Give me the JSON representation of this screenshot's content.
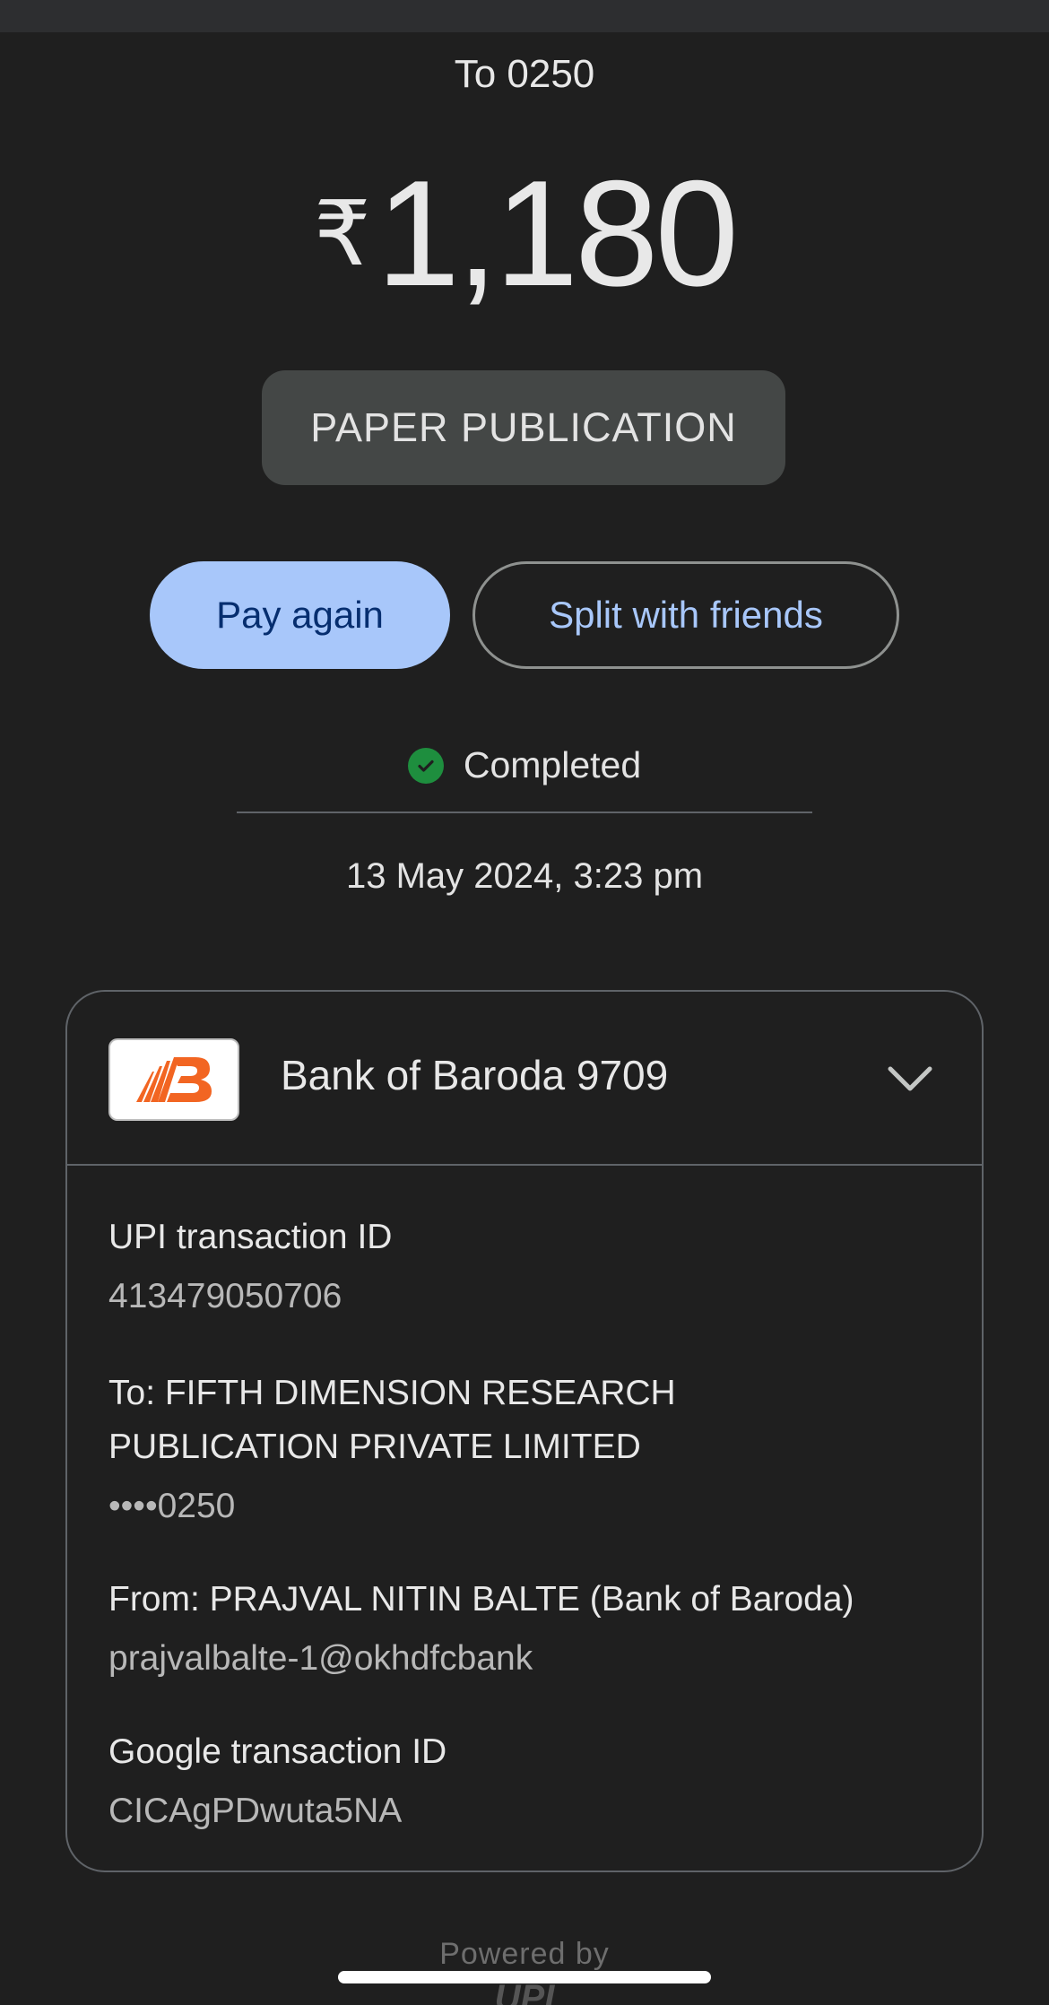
{
  "header": {
    "to_title": "To 0250"
  },
  "amount": {
    "currency": "₹",
    "value": "1,180"
  },
  "note": "PAPER PUBLICATION",
  "actions": {
    "pay_again": "Pay again",
    "split": "Split with friends"
  },
  "status": {
    "text": "Completed",
    "color": "#1e8e3e"
  },
  "datetime": "13 May 2024, 3:23 pm",
  "bank": {
    "name": "Bank of Baroda 9709",
    "logo_color": "#f26522"
  },
  "details": {
    "upi_label": "UPI transaction ID",
    "upi_value": "413479050706",
    "to_label_line1": "To: FIFTH DIMENSION RESEARCH",
    "to_label_line2": "PUBLICATION PRIVATE LIMITED",
    "to_value": "••••0250",
    "from_label": "From: PRAJVAL NITIN BALTE (Bank of Baroda)",
    "from_value": "prajvalbalte-1@okhdfcbank",
    "google_label": "Google transaction ID",
    "google_value": "CICAgPDwuta5NA"
  },
  "footer": {
    "powered_by": "Powered by",
    "logo_text": "UPI"
  },
  "icons": {
    "status": "check-circle-icon",
    "expand": "chevron-down-icon",
    "bank_logo": "bank-of-baroda-logo"
  },
  "colors": {
    "background": "#1f1f1f",
    "primary_button": "#a8c7fa",
    "link": "#a8c7fa",
    "chip": "#444746"
  }
}
